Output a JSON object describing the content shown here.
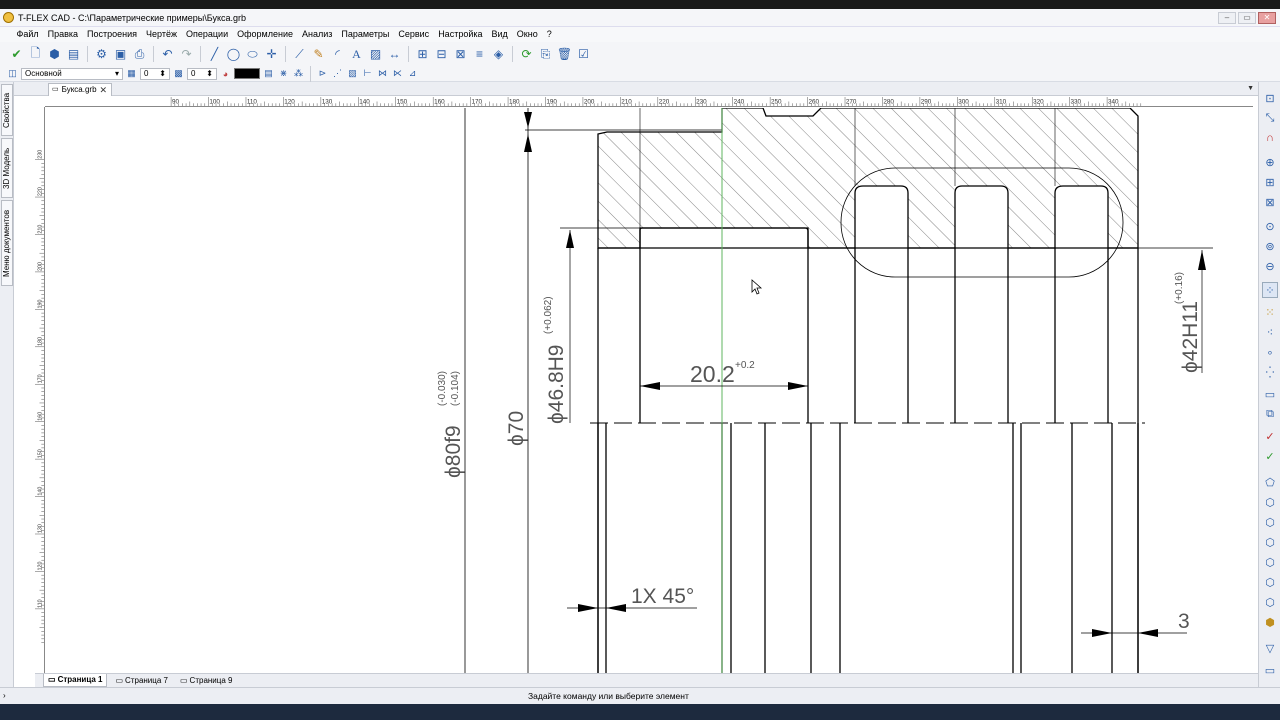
{
  "window": {
    "title": "T-FLEX CAD - C:\\Параметрические примеры\\Букса.grb",
    "controls": [
      "‒",
      "▭",
      "✕"
    ]
  },
  "menu": [
    "Файл",
    "Правка",
    "Построения",
    "Чертёж",
    "Операции",
    "Оформление",
    "Анализ",
    "Параметры",
    "Сервис",
    "Настройка",
    "Вид",
    "Окно",
    "?"
  ],
  "toolbar2": {
    "layer_value": "Основной",
    "level_value": "0",
    "priority_value": "0",
    "color": "#000000"
  },
  "left_panel_tabs": [
    "Свойства",
    "3D Модель",
    "Меню документов"
  ],
  "document_tab": {
    "label": "Букса.grb",
    "close": "✕"
  },
  "ruler": {
    "top_labels": [
      "90",
      "100",
      "110",
      "120",
      "130",
      "140",
      "150",
      "160",
      "170",
      "180",
      "190",
      "200",
      "210",
      "220",
      "230",
      "240",
      "250",
      "260",
      "270",
      "280",
      "290",
      "300",
      "310",
      "320",
      "330",
      "340"
    ],
    "left_labels": [
      "230",
      "220",
      "210",
      "200",
      "190",
      "180",
      "170",
      "160",
      "150",
      "140",
      "130",
      "120",
      "110"
    ]
  },
  "drawing": {
    "dim_phi80": "ϕ80f9",
    "dim_phi80_tol_upper": "(-0.030)",
    "dim_phi80_tol_lower": "(-0.104)",
    "dim_phi70": "ϕ70",
    "dim_phi46": "ϕ46.8H9",
    "dim_phi46_tol": "(+0.062)",
    "dim_20": "20.2",
    "dim_20_tol": "+0.2",
    "dim_chamfer": "1X 45°",
    "dim_phi42": "ϕ42H11",
    "dim_phi42_tol": "(+0.16)",
    "dim_3": "3"
  },
  "page_tabs": [
    "Страница 1",
    "Страница 7",
    "Страница 9"
  ],
  "status": {
    "message": "Задайте команду или выберите элемент"
  }
}
